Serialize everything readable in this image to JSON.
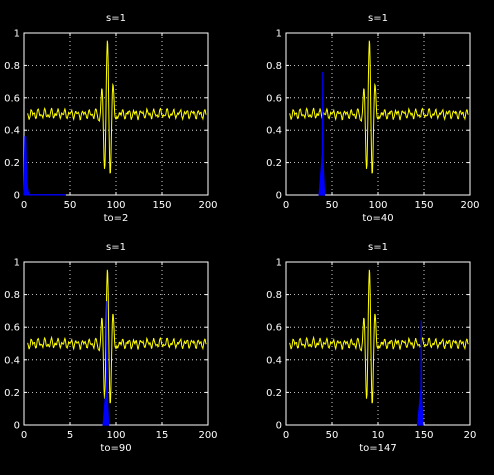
{
  "colors": {
    "background": "#000000",
    "axes": "#ffffff",
    "grid": "#ffffff",
    "signal": "#ffff00",
    "window": "#0000ff"
  },
  "chart_data": [
    {
      "type": "line",
      "title": "s=1",
      "xlabel": "to=2",
      "xlim": [
        0,
        200
      ],
      "ylim": [
        0,
        1
      ],
      "xticks": [
        0,
        50,
        100,
        150,
        200
      ],
      "xtick_labels": [
        "0",
        "50",
        "100",
        "150",
        "200"
      ],
      "yticks": [
        0,
        0.2,
        0.4,
        0.6,
        0.8,
        1
      ],
      "ytick_labels": [
        "0",
        "0.2",
        "0.4",
        "0.6",
        "0.8",
        "1"
      ],
      "grid": true,
      "window": {
        "start": 0,
        "end": 45,
        "peak": 0.36,
        "peak_at": 2,
        "shape": "decay"
      },
      "signal": {
        "baseline": 0.5,
        "center": 91,
        "amplitude": 0.46
      }
    },
    {
      "type": "line",
      "title": "s=1",
      "xlabel": "to=40",
      "xlim": [
        0,
        200
      ],
      "ylim": [
        0,
        1
      ],
      "xticks": [
        0,
        50,
        100,
        150,
        200
      ],
      "xtick_labels": [
        "0",
        "50",
        "100",
        "150",
        "200"
      ],
      "yticks": [
        0,
        0.2,
        0.4,
        0.6,
        0.8,
        1
      ],
      "ytick_labels": [
        "0",
        "0.2",
        "0.4",
        "0.6",
        "0.8",
        "1"
      ],
      "grid": true,
      "window": {
        "start": 36,
        "end": 42,
        "peak": 0.76,
        "peak_at": 40,
        "shape": "spike"
      },
      "signal": {
        "baseline": 0.5,
        "center": 91,
        "amplitude": 0.46
      }
    },
    {
      "type": "line",
      "title": "s=1",
      "xlabel": "to=90",
      "xlim": [
        0,
        200
      ],
      "ylim": [
        0,
        1
      ],
      "xticks": [
        0,
        50,
        100,
        150,
        200
      ],
      "xtick_labels": [
        "0",
        "5",
        "100",
        "15",
        "200"
      ],
      "yticks": [
        0,
        0.2,
        0.4,
        0.6,
        0.8,
        1
      ],
      "ytick_labels": [
        "0",
        "0.2",
        "0.4",
        "0.6",
        "0.8",
        "1"
      ],
      "grid": true,
      "window": {
        "start": 86,
        "end": 92,
        "peak": 0.76,
        "peak_at": 90,
        "shape": "spike"
      },
      "signal": {
        "baseline": 0.5,
        "center": 91,
        "amplitude": 0.46
      }
    },
    {
      "type": "line",
      "title": "s=1",
      "xlabel": "to=147",
      "xlim": [
        0,
        200
      ],
      "ylim": [
        0,
        1
      ],
      "xticks": [
        0,
        50,
        100,
        150,
        200
      ],
      "xtick_labels": [
        "0",
        "50",
        "10",
        "150",
        "20"
      ],
      "yticks": [
        0,
        0.2,
        0.4,
        0.6,
        0.8,
        1
      ],
      "ytick_labels": [
        "0",
        "0.2",
        "0.4",
        "0.6",
        "0.8",
        "1"
      ],
      "grid": true,
      "window": {
        "start": 143,
        "end": 149,
        "peak": 0.64,
        "peak_at": 147,
        "shape": "spike"
      },
      "signal": {
        "baseline": 0.5,
        "center": 91,
        "amplitude": 0.46
      }
    }
  ]
}
